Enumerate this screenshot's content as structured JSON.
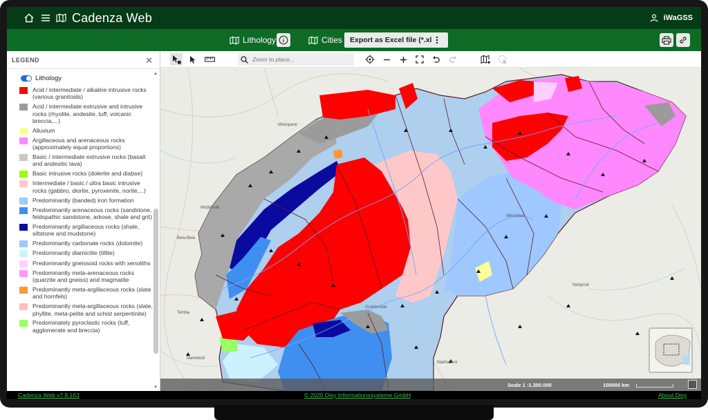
{
  "app": {
    "title": "Cadenza Web",
    "user": "iWaGSS"
  },
  "toolbar": {
    "lithology_label": "Lithology",
    "cities_label": "Cities",
    "export_label": "Export as Excel file (*.xlsx)"
  },
  "legend": {
    "title": "LEGEND",
    "layer_name": "Lithology",
    "items": [
      {
        "color": "#ff0000",
        "label": "Acid / intermediate / alkaline intrusive rocks (various granitoids)"
      },
      {
        "color": "#9b9b9b",
        "label": "Acid / intermediate extrusive and intrusive rocks (rhyolite, andesite, tuff, volcanic breccia,...)"
      },
      {
        "color": "#ffff99",
        "label": "Alluvium"
      },
      {
        "color": "#ff88ff",
        "label": "Argillaceous and arenaceous rocks (approximately equal proportions)"
      },
      {
        "color": "#c8c8c8",
        "label": "Basic / intermediate extrusive rocks (basalt and andesitic lava)"
      },
      {
        "color": "#99ff00",
        "label": "Basic intrusive rocks (dolerite and diabse)"
      },
      {
        "color": "#ffc8c8",
        "label": "Intermediate / basic / ultra basic intrusive rocks (gabbro, diorite, pyroxenite, norite,...)"
      },
      {
        "color": "#99ccff",
        "label": "Predominantly (banded) iron formation"
      },
      {
        "color": "#3f8ff0",
        "label": "Predominantly arenaceous rocks (sandstone, feldspathic sandstone, arkose, shale and grit)"
      },
      {
        "color": "#0a0a9e",
        "label": "Predominantly argillaceous rocks (shale, siltstone and mudstone)"
      },
      {
        "color": "#9ec8ff",
        "label": "Predominantly carbonate rocks (dolomite)"
      },
      {
        "color": "#ccf2ff",
        "label": "Predominantly diamictite (tillite)"
      },
      {
        "color": "#ffcfff",
        "label": "Predominantly gneissoid rocks with xenoliths"
      },
      {
        "color": "#ff99ff",
        "label": "Predominantly meta-arenaceous rocks (quarzite and gneiss) and magmatite"
      },
      {
        "color": "#ff9933",
        "label": "Predominantly meta-argillaceous rocks (slate and hornfels)"
      },
      {
        "color": "#ffbfbf",
        "label": "Predominantly meta-argillaceous rocks (slate, phyllite, meta-pelite and schist serpentinite)"
      },
      {
        "color": "#99ff66",
        "label": "Predominately pyroclastic rocks (tuff, agglomerate and breccia)"
      }
    ]
  },
  "map": {
    "search_placeholder": "Zoom to place...",
    "scale_label": "Scale 1 :1.300.000",
    "scalebar_label": "100000 km",
    "places": [
      "Mokopane",
      "Modimolle",
      "Bela-Bela",
      "Temba",
      "Mamelodi",
      "Groblersdal",
      "Mbombela",
      "Makhazeni",
      "Nelspruit"
    ]
  },
  "footer": {
    "version": "Cadenza Web v7.9.163",
    "copyright": "© 2020 Disy Informationssysteme GmbH",
    "about": "About Disy"
  }
}
